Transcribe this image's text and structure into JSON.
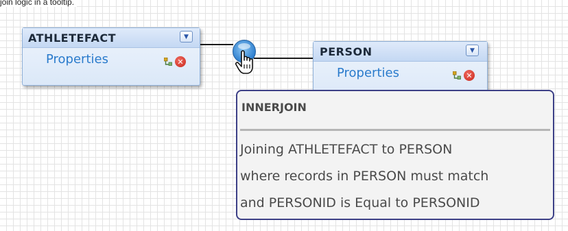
{
  "caption": "join logic in a tooltip.",
  "entities": [
    {
      "title": "ATHLETEFACT",
      "properties_label": "Properties"
    },
    {
      "title": "PERSON",
      "properties_label": "Properties"
    }
  ],
  "icons": {
    "dropdown": "chevron-down-icon",
    "key": "key-icon",
    "delete": "delete-icon",
    "join": "join-icon",
    "cursor": "hand-cursor-icon"
  },
  "colors": {
    "link": "#2a7bcc",
    "tooltip_border": "#3c3f86",
    "delete": "#c8261c",
    "join": "#2d7fcf"
  },
  "tooltip": {
    "title": "INNERJOIN",
    "lines": [
      "Joining ATHLETEFACT to PERSON",
      "where records in PERSON must match",
      "and PERSONID is Equal to PERSONID"
    ]
  }
}
